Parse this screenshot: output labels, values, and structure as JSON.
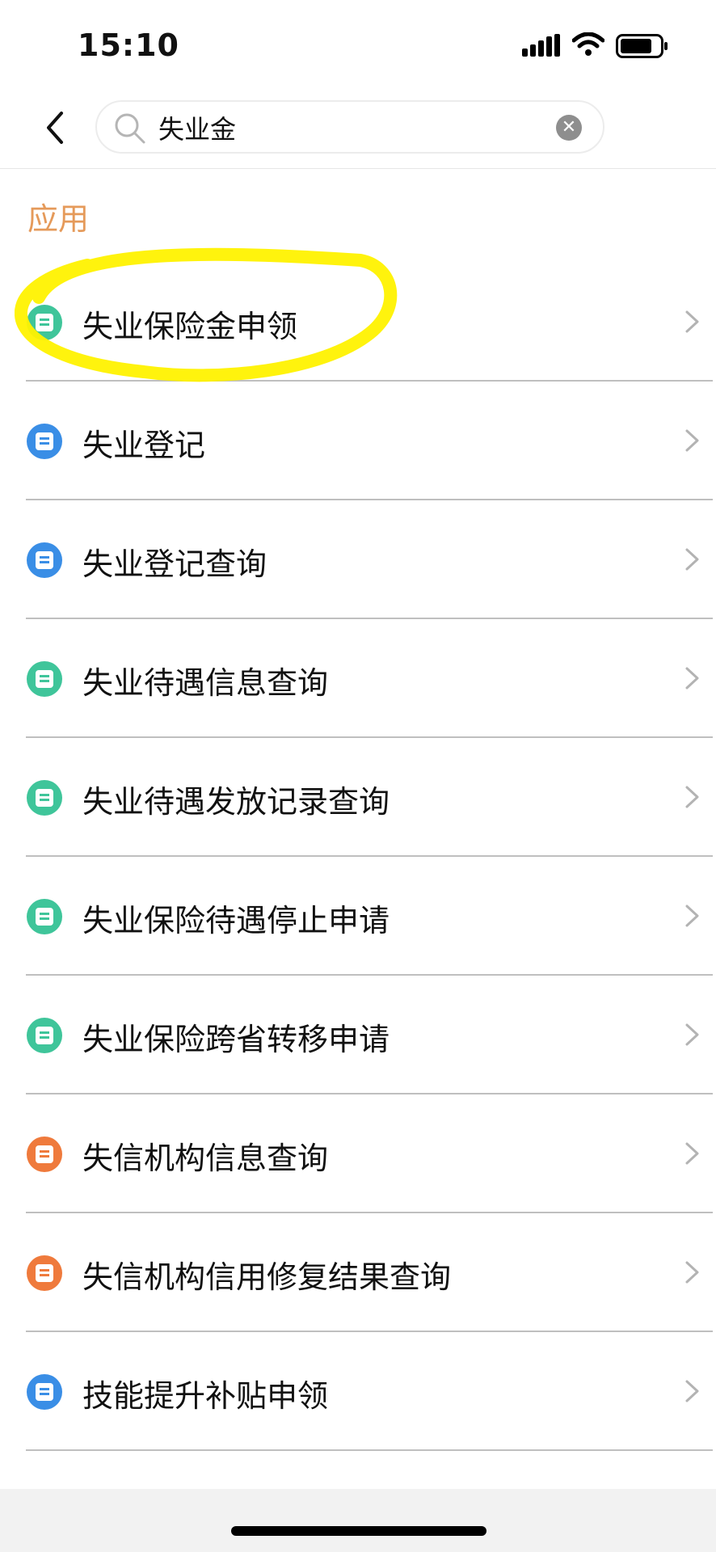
{
  "status_bar": {
    "time": "15:10"
  },
  "search": {
    "value": "失业金"
  },
  "section_title": "应用",
  "items": [
    {
      "label": "失业保险金申领",
      "color": "#3fc59a",
      "icon": "unemployment-person-icon",
      "highlighted": true
    },
    {
      "label": "失业登记",
      "color": "#3a8ee6",
      "icon": "shield-icon"
    },
    {
      "label": "失业登记查询",
      "color": "#3a8ee6",
      "icon": "shield-search-icon"
    },
    {
      "label": "失业待遇信息查询",
      "color": "#3fc59a",
      "icon": "unemployment-person-icon"
    },
    {
      "label": "失业待遇发放记录查询",
      "color": "#3fc59a",
      "icon": "unemployment-search-icon"
    },
    {
      "label": "失业保险待遇停止申请",
      "color": "#3fc59a",
      "icon": "form-icon"
    },
    {
      "label": "失业保险跨省转移申请",
      "color": "#3fc59a",
      "icon": "form-icon"
    },
    {
      "label": "失信机构信息查询",
      "color": "#ef7a3c",
      "icon": "form-icon"
    },
    {
      "label": "失信机构信用修复结果查询",
      "color": "#ef7a3c",
      "icon": "form-icon"
    },
    {
      "label": "技能提升补贴申领",
      "color": "#3a8ee6",
      "icon": "form-icon"
    }
  ]
}
